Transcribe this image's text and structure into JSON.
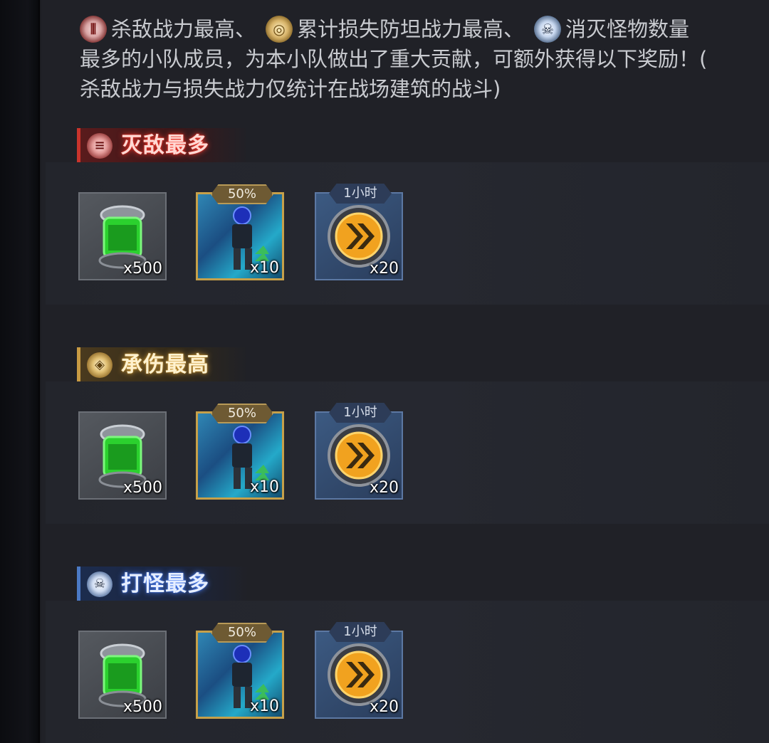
{
  "description": {
    "kill_label": "杀敌战力最高、",
    "loss_label": "累计损失防坦战力最高、",
    "monster_label": "消灭怪物数量",
    "line2": "最多的小队成员，为本小队做出了重大贡献，可额外获得以下奖励！(",
    "line3": "杀敌战力与损失战力仅统计在战场建筑的战斗)"
  },
  "sections": [
    {
      "title": "灭敌最多",
      "theme": "red",
      "icon": "crosshair-icon",
      "rewards": [
        {
          "icon": "green-crystal-canister-icon",
          "count": "x500",
          "tag": ""
        },
        {
          "icon": "soldier-upgrade-icon",
          "count": "x10",
          "tag": "50%"
        },
        {
          "icon": "speedup-arrow-icon",
          "count": "x20",
          "tag": "1小时"
        }
      ]
    },
    {
      "title": "承伤最高",
      "theme": "gold",
      "icon": "shield-icon",
      "rewards": [
        {
          "icon": "green-crystal-canister-icon",
          "count": "x500",
          "tag": ""
        },
        {
          "icon": "soldier-upgrade-icon",
          "count": "x10",
          "tag": "50%"
        },
        {
          "icon": "speedup-arrow-icon",
          "count": "x20",
          "tag": "1小时"
        }
      ]
    },
    {
      "title": "打怪最多",
      "theme": "blue",
      "icon": "skull-icon",
      "rewards": [
        {
          "icon": "green-crystal-canister-icon",
          "count": "x500",
          "tag": ""
        },
        {
          "icon": "soldier-upgrade-icon",
          "count": "x10",
          "tag": "50%"
        },
        {
          "icon": "speedup-arrow-icon",
          "count": "x20",
          "tag": "1小时"
        }
      ]
    }
  ],
  "colors": {
    "red_accent": "#c8342c",
    "gold_accent": "#c79a43",
    "blue_accent": "#4b79c4",
    "panel_bg": "#202127"
  }
}
